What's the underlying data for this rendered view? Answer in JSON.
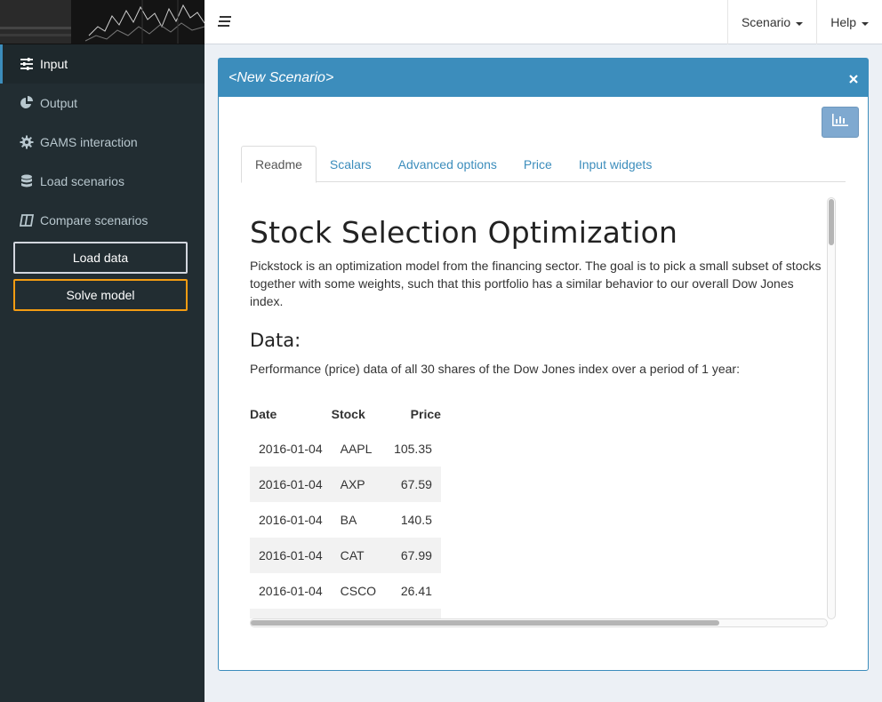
{
  "sidebar": {
    "items": [
      {
        "label": "Input",
        "icon": "sliders-icon",
        "active": true
      },
      {
        "label": "Output",
        "icon": "pie-chart-icon",
        "active": false
      },
      {
        "label": "GAMS interaction",
        "icon": "gear-icon",
        "active": false
      },
      {
        "label": "Load scenarios",
        "icon": "database-icon",
        "active": false
      },
      {
        "label": "Compare scenarios",
        "icon": "columns-icon",
        "active": false
      }
    ],
    "load_data_label": "Load data",
    "solve_model_label": "Solve model"
  },
  "header": {
    "scenario_label": "Scenario",
    "help_label": "Help"
  },
  "box": {
    "title": "<New Scenario>"
  },
  "tabs": [
    "Readme",
    "Scalars",
    "Advanced options",
    "Price",
    "Input widgets"
  ],
  "readme": {
    "title": "Stock Selection Optimization",
    "description": "Pickstock is an optimization model from the financing sector. The goal is to pick a small subset of stocks together with some weights, such that this portfolio has a similar behavior to our overall Dow Jones index.",
    "data_heading": "Data:",
    "data_text": "Performance (price) data of all 30 shares of the Dow Jones index over a period of 1 year:",
    "table": {
      "headers": [
        "Date",
        "Stock",
        "Price"
      ],
      "rows": [
        [
          "2016-01-04",
          "AAPL",
          "105.35"
        ],
        [
          "2016-01-04",
          "AXP",
          "67.59"
        ],
        [
          "2016-01-04",
          "BA",
          "140.5"
        ],
        [
          "2016-01-04",
          "CAT",
          "67.99"
        ],
        [
          "2016-01-04",
          "CSCO",
          "26.41"
        ],
        [
          "",
          "",
          ""
        ]
      ]
    }
  },
  "colors": {
    "sidebar_bg": "#222d32",
    "accent": "#3c8dbc",
    "solve_border": "#f39c12"
  }
}
